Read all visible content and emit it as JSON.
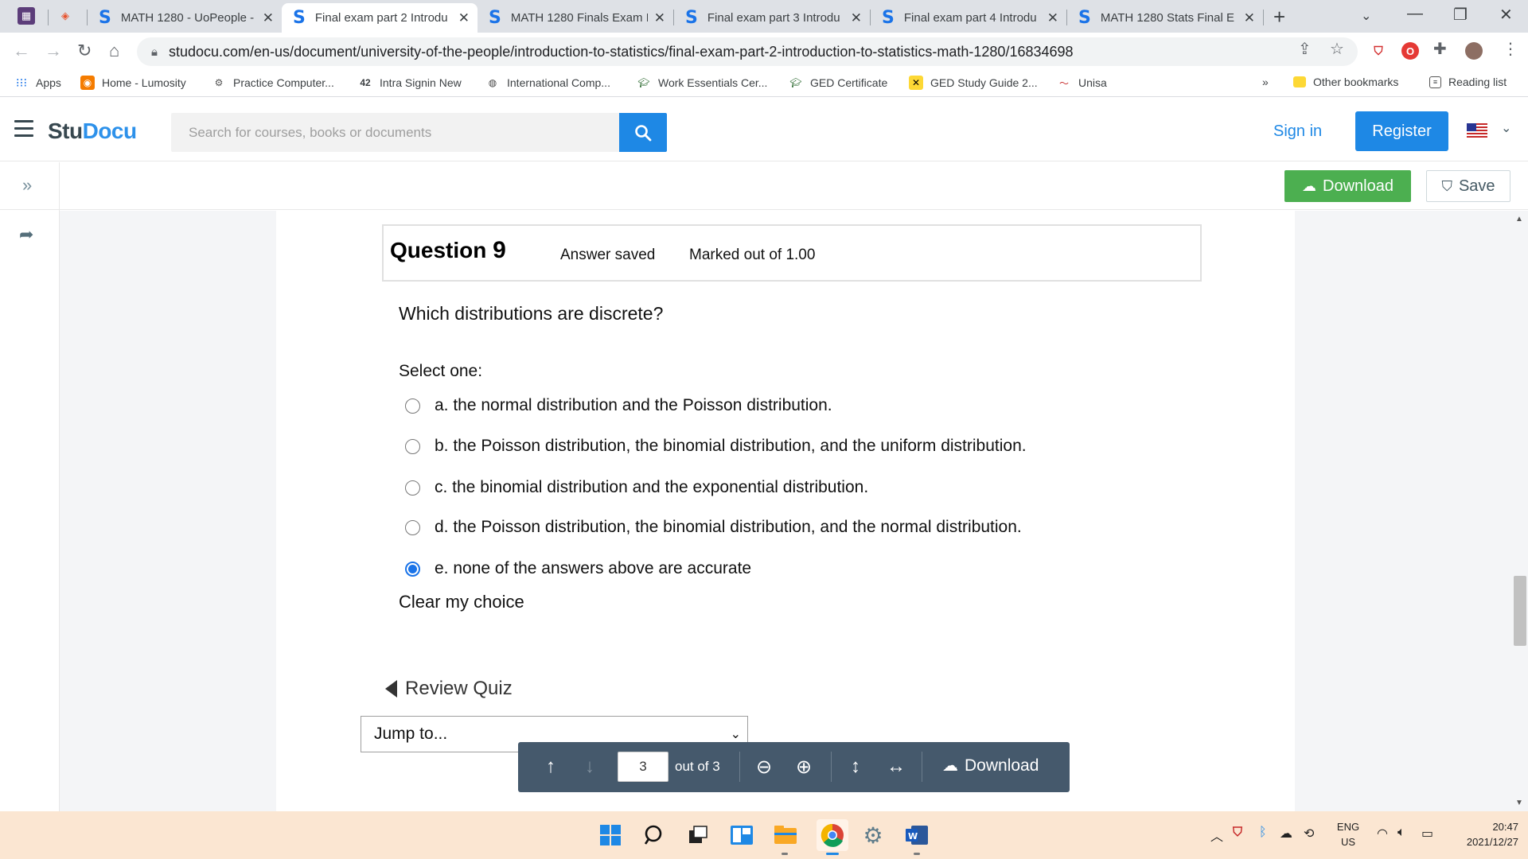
{
  "browser": {
    "tabs": [
      {
        "title": "MATH 1280 - UoPeople -",
        "active": false
      },
      {
        "title": "Final exam part 2 Introdu",
        "active": true
      },
      {
        "title": "MATH 1280 Finals Exam I",
        "active": false
      },
      {
        "title": "Final exam part 3 Introdu",
        "active": false
      },
      {
        "title": "Final exam part 4 Introdu",
        "active": false
      },
      {
        "title": "MATH 1280 Stats Final E",
        "active": false
      }
    ],
    "new_tab_label": "+",
    "url": "studocu.com/en-us/document/university-of-the-people/introduction-to-statistics/final-exam-part-2-introduction-to-statistics-math-1280/16834698",
    "bookmarks": [
      "Apps",
      "Home - Lumosity",
      "Practice Computer...",
      "Intra Signin New",
      "International Comp...",
      "Work Essentials Cer...",
      "GED Certificate",
      "GED Study Guide 2...",
      "Unisa"
    ],
    "bookmarks_overflow": "»",
    "other_bookmarks": "Other bookmarks",
    "reading_list": "Reading list"
  },
  "site": {
    "logo_part1": "Stu",
    "logo_part2": "Docu",
    "search_placeholder": "Search for courses, books or documents",
    "sign_in": "Sign in",
    "register": "Register",
    "download": "Download",
    "save": "Save"
  },
  "question": {
    "label": "Question",
    "number": "9",
    "status": "Answer saved",
    "marks": "Marked out of 1.00",
    "text": "Which distributions are discrete?",
    "select_one": "Select one:",
    "options": [
      {
        "text": "a. the normal distribution and the Poisson distribution.",
        "selected": false
      },
      {
        "text": "b. the Poisson distribution, the binomial distribution, and the uniform distribution.",
        "selected": false
      },
      {
        "text": "c. the binomial distribution and the exponential distribution.",
        "selected": false
      },
      {
        "text": "d. the Poisson distribution, the binomial distribution, and the normal distribution.",
        "selected": false
      },
      {
        "text": "e. none of the answers above are accurate",
        "selected": true
      }
    ],
    "clear_choice": "Clear my choice",
    "review_quiz_first": "R",
    "review_quiz_rest": "eview Quiz",
    "jump_to": "Jump to..."
  },
  "page_toolbar": {
    "current_page": "3",
    "out_of": "out of 3",
    "download": "Download"
  },
  "taskbar": {
    "lang_top": "ENG",
    "lang_bottom": "US",
    "time": "20:47",
    "date": "2021/12/27"
  },
  "colors": {
    "accent": "#1e88e5",
    "download_green": "#4caf50",
    "toolbar_slate": "#45596c",
    "taskbar": "#fbe6d2"
  }
}
